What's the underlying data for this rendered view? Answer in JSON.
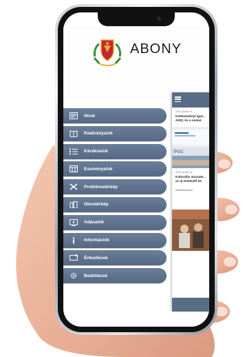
{
  "app": {
    "title": "ABONY"
  },
  "menu": {
    "items": [
      {
        "label": "Hírek",
        "icon": "news-icon"
      },
      {
        "label": "Kiadványaink",
        "icon": "book-icon"
      },
      {
        "label": "Kérdéseink",
        "icon": "list-icon"
      },
      {
        "label": "Eseményeink",
        "icon": "calendar-icon"
      },
      {
        "label": "Problématérkép",
        "icon": "tools-icon"
      },
      {
        "label": "Okostérkép",
        "icon": "building-icon"
      },
      {
        "label": "Adásaink",
        "icon": "tv-icon"
      },
      {
        "label": "Információk",
        "icon": "info-icon"
      },
      {
        "label": "Értesítések",
        "icon": "message-icon"
      },
      {
        "label": "Beállítások",
        "icon": "gear-icon"
      }
    ]
  },
  "peek": {
    "date_1": "2020. január 31.",
    "headline_1": "Kedvezményt igaz... AVID, és a szemé",
    "date_2": "2020. január 31.",
    "headline_2": "Kulturális visszate... az új esztendő be",
    "caption_2": "Kulturális tudósí"
  },
  "colors": {
    "menu_bg": "#5f7390",
    "brand_text": "#1c1c1c",
    "logo_red": "#c8252c",
    "logo_gold": "#e3b23c"
  }
}
